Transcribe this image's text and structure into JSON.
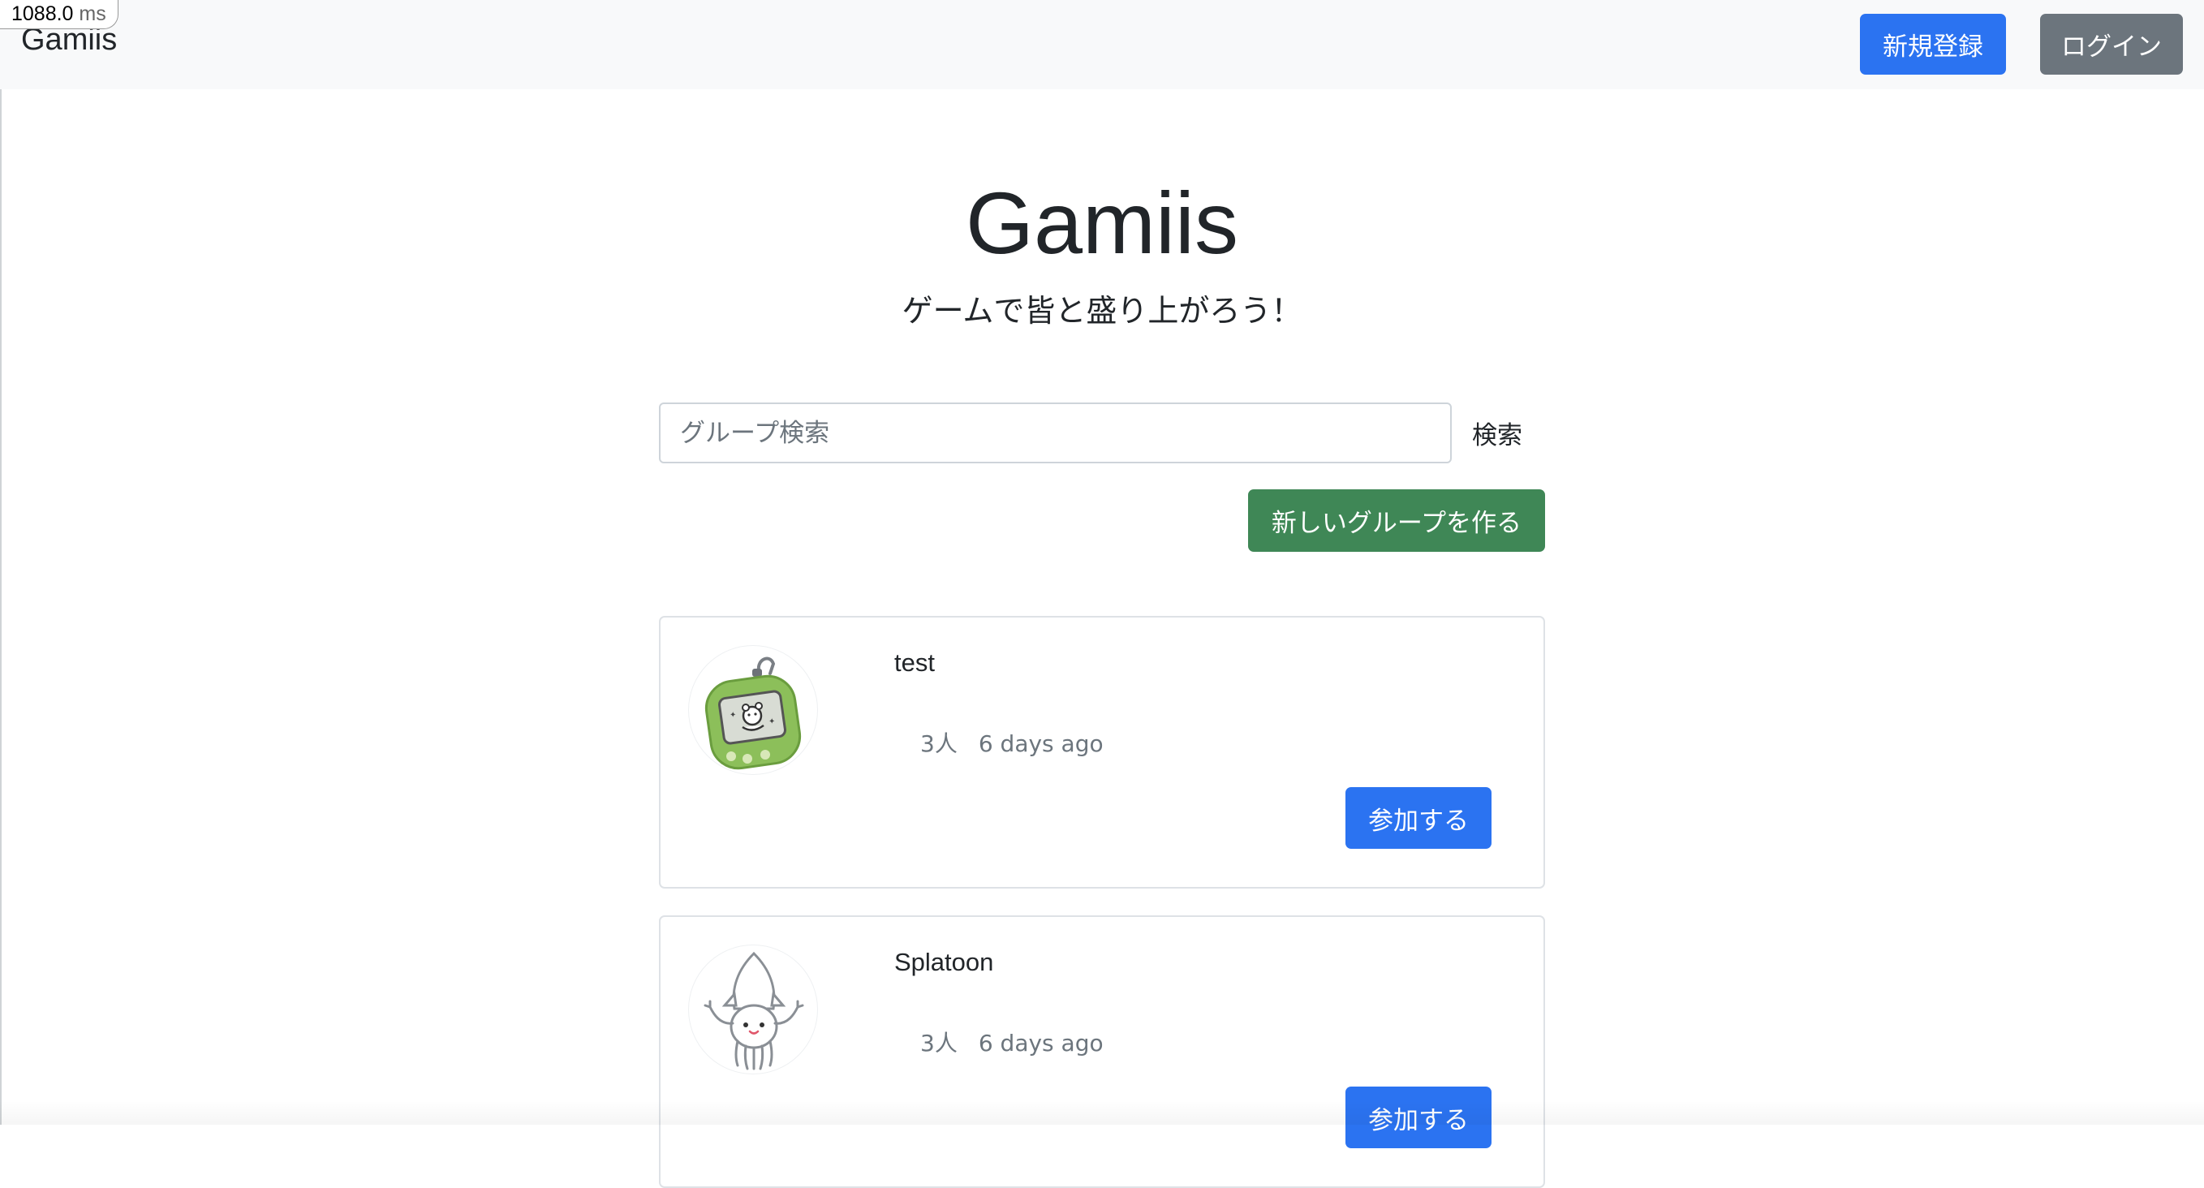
{
  "perf": {
    "value": "1088.0",
    "unit": "ms"
  },
  "navbar": {
    "brand": "Gamiis",
    "signup_label": "新規登録",
    "login_label": "ログイン"
  },
  "hero": {
    "title": "Gamiis",
    "subtitle": "ゲームで皆と盛り上がろう！"
  },
  "search": {
    "placeholder": "グループ検索",
    "value": "",
    "button_label": "検索"
  },
  "create_group_label": "新しいグループを作る",
  "groups": [
    {
      "name": "test",
      "members": "3人",
      "updated": "6 days ago",
      "join_label": "参加する",
      "icon": "game-device-icon"
    },
    {
      "name": "Splatoon",
      "members": "3人",
      "updated": "6 days ago",
      "join_label": "参加する",
      "icon": "squid-icon"
    }
  ],
  "colors": {
    "primary": "#2b73f1",
    "secondary": "#6c757d",
    "success": "#3f8756",
    "navbar_bg": "#f8f9fa"
  }
}
